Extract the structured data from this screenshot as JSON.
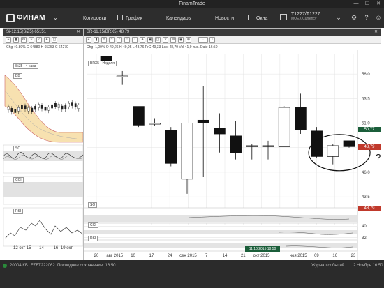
{
  "window": {
    "title": "FinamTrade",
    "min": "—",
    "max": "☐",
    "close": "✕"
  },
  "toolbar": {
    "logo": "ФИНАМ",
    "items": [
      {
        "label": "Котировки",
        "icon": "quotes-icon"
      },
      {
        "label": "График",
        "icon": "chart-icon"
      },
      {
        "label": "Календарь",
        "icon": "calendar-icon"
      },
      {
        "label": "Новости",
        "icon": "news-icon"
      },
      {
        "label": "Окна",
        "icon": "windows-icon"
      }
    ],
    "account": {
      "id": "T1227/T1227",
      "market": "MOEX Currency"
    }
  },
  "left_panel": {
    "header": "Si-12.15(SiZ5) 65151",
    "info": "Chg +0.89% O 64880 H 65253 C 64270",
    "main_label": "SiZ5 - 4 часа",
    "bb_label": "BB",
    "so_label": "SO",
    "cci_label": "CCI",
    "rsi_label": "RSI",
    "x_labels": [
      "12 окт 15",
      "14",
      "16",
      "19 окт"
    ]
  },
  "main_panel": {
    "header": "BR-11.15(BRX5) 48,79",
    "info": "Chg -1,09%  O 49,26  H 49,95  L 48,76  PrC 49,33  Last 48,79  Vol 41,9 тыс.  Date 16:50",
    "chart_label": "BRX5 - Неделя",
    "so_label": "SO",
    "cci_label": "CCI",
    "rsi_label": "RSI",
    "annotation": "?",
    "last_price": "48,79",
    "prev_price": "50,77",
    "so_value": "48,79",
    "cci_value": "40",
    "rsi_value": "32",
    "crosshair_label": "11.10.2015 18:50"
  },
  "status": {
    "account": "20004 КБ",
    "id": "FZFT222062",
    "save": "Последнее сохранение: 16:50",
    "log": "Журнал событий",
    "date": "2 Ноябрь 16:50"
  },
  "chart_data": {
    "type": "candlestick",
    "title": "BRX5 - Неделя",
    "y_ticks": [
      56.0,
      53.5,
      51.0,
      48.5,
      46.0,
      43.5
    ],
    "ylim": [
      42.8,
      58.0
    ],
    "x_tick_labels": [
      "20",
      "авг 2015",
      "10",
      "17",
      "24",
      "сен 2015",
      "7",
      "14",
      "21",
      "окт 2015",
      "11.10.2015 18:50",
      "ноя 2015",
      "09",
      "16",
      "23"
    ],
    "candles": [
      {
        "o": 57.8,
        "h": 57.8,
        "l": 57.0,
        "c": 57.1
      },
      {
        "o": 55.8,
        "h": 56.3,
        "l": 54.9,
        "c": 55.8
      },
      {
        "o": 52.7,
        "h": 52.7,
        "l": 50.6,
        "c": 50.8
      },
      {
        "o": 51.0,
        "h": 51.5,
        "l": 50.7,
        "c": 51.0
      },
      {
        "o": 50.3,
        "h": 50.6,
        "l": 46.6,
        "c": 46.9
      },
      {
        "o": 45.3,
        "h": 51.0,
        "l": 43.8,
        "c": 51.0
      },
      {
        "o": 51.3,
        "h": 54.8,
        "l": 45.5,
        "c": 51.0
      },
      {
        "o": 50.5,
        "h": 52.0,
        "l": 48.0,
        "c": 49.9
      },
      {
        "o": 49.7,
        "h": 51.2,
        "l": 47.3,
        "c": 48.0
      },
      {
        "o": 48.7,
        "h": 48.9,
        "l": 47.3,
        "c": 48.7
      },
      {
        "o": 48.7,
        "h": 49.2,
        "l": 47.3,
        "c": 48.7
      },
      {
        "o": 48.6,
        "h": 52.7,
        "l": 48.6,
        "c": 52.6
      },
      {
        "o": 52.6,
        "h": 54.0,
        "l": 49.9,
        "c": 50.3
      },
      {
        "o": 50.2,
        "h": 50.6,
        "l": 47.5,
        "c": 47.6
      },
      {
        "o": 47.6,
        "h": 48.9,
        "l": 46.8,
        "c": 48.7
      },
      {
        "o": 49.2,
        "h": 49.2,
        "l": 48.5,
        "c": 48.6
      }
    ],
    "price_ticks_right": [
      "56,0",
      "53,5",
      "50,77",
      "48,79",
      "46,0",
      "43,5"
    ]
  }
}
